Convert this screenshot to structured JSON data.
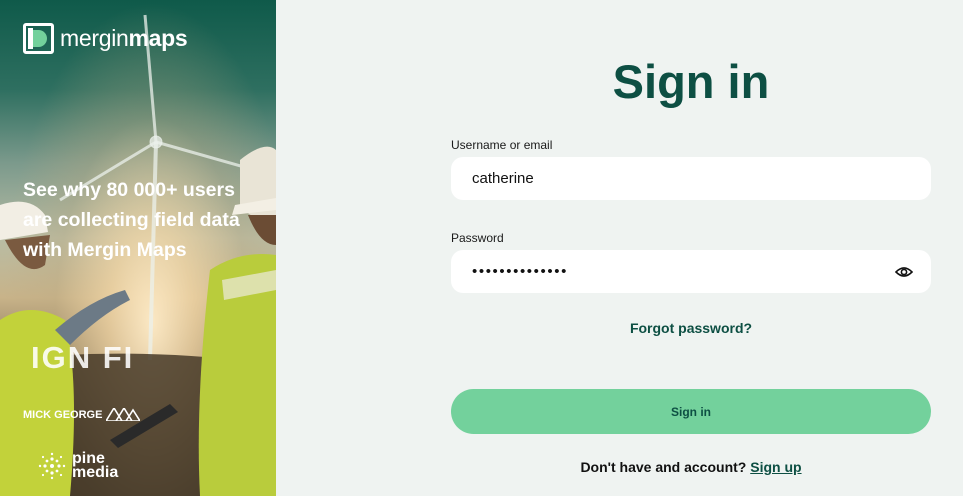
{
  "brand": {
    "logo_light": "mergin",
    "logo_bold": "maps",
    "tagline": "See why 80 000+ users are collecting field data with Mergin Maps",
    "partners": {
      "ign": "IGN FI",
      "mick": "MICK GEORGE",
      "pine_top": "pine",
      "pine_bottom": "media"
    }
  },
  "form": {
    "title": "Sign in",
    "username_label": "Username or email",
    "username_value": "catherine",
    "password_label": "Password",
    "password_masked": "••••••••••••••",
    "forgot_label": "Forgot password?",
    "submit_label": "Sign in",
    "signup_prompt": "Don't have and account?",
    "signup_link": "Sign up"
  },
  "colors": {
    "accent": "#73d19c",
    "brand_dark": "#0d4f43",
    "background": "#eff3f1"
  },
  "icons": {
    "password_toggle": "eye-icon"
  }
}
